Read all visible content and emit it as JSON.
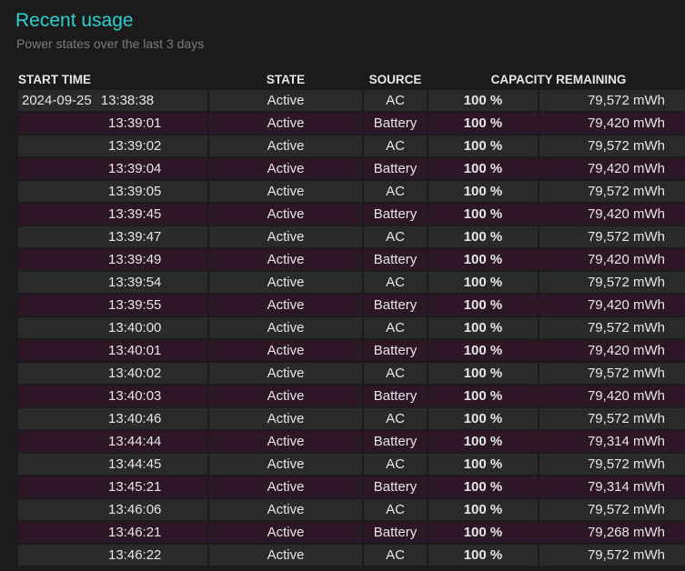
{
  "header": {
    "title": "Recent usage",
    "subtitle": "Power states over the last 3 days"
  },
  "table": {
    "columns": {
      "start_time": "START TIME",
      "state": "STATE",
      "source": "SOURCE",
      "capacity": "CAPACITY REMAINING"
    },
    "rows": [
      {
        "date": "2024-09-25",
        "time": "13:38:38",
        "state": "Active",
        "source": "AC",
        "percent": "100 %",
        "mwh": "79,572 mWh"
      },
      {
        "date": "",
        "time": "13:39:01",
        "state": "Active",
        "source": "Battery",
        "percent": "100 %",
        "mwh": "79,420 mWh"
      },
      {
        "date": "",
        "time": "13:39:02",
        "state": "Active",
        "source": "AC",
        "percent": "100 %",
        "mwh": "79,572 mWh"
      },
      {
        "date": "",
        "time": "13:39:04",
        "state": "Active",
        "source": "Battery",
        "percent": "100 %",
        "mwh": "79,420 mWh"
      },
      {
        "date": "",
        "time": "13:39:05",
        "state": "Active",
        "source": "AC",
        "percent": "100 %",
        "mwh": "79,572 mWh"
      },
      {
        "date": "",
        "time": "13:39:45",
        "state": "Active",
        "source": "Battery",
        "percent": "100 %",
        "mwh": "79,420 mWh"
      },
      {
        "date": "",
        "time": "13:39:47",
        "state": "Active",
        "source": "AC",
        "percent": "100 %",
        "mwh": "79,572 mWh"
      },
      {
        "date": "",
        "time": "13:39:49",
        "state": "Active",
        "source": "Battery",
        "percent": "100 %",
        "mwh": "79,420 mWh"
      },
      {
        "date": "",
        "time": "13:39:54",
        "state": "Active",
        "source": "AC",
        "percent": "100 %",
        "mwh": "79,572 mWh"
      },
      {
        "date": "",
        "time": "13:39:55",
        "state": "Active",
        "source": "Battery",
        "percent": "100 %",
        "mwh": "79,420 mWh"
      },
      {
        "date": "",
        "time": "13:40:00",
        "state": "Active",
        "source": "AC",
        "percent": "100 %",
        "mwh": "79,572 mWh"
      },
      {
        "date": "",
        "time": "13:40:01",
        "state": "Active",
        "source": "Battery",
        "percent": "100 %",
        "mwh": "79,420 mWh"
      },
      {
        "date": "",
        "time": "13:40:02",
        "state": "Active",
        "source": "AC",
        "percent": "100 %",
        "mwh": "79,572 mWh"
      },
      {
        "date": "",
        "time": "13:40:03",
        "state": "Active",
        "source": "Battery",
        "percent": "100 %",
        "mwh": "79,420 mWh"
      },
      {
        "date": "",
        "time": "13:40:46",
        "state": "Active",
        "source": "AC",
        "percent": "100 %",
        "mwh": "79,572 mWh"
      },
      {
        "date": "",
        "time": "13:44:44",
        "state": "Active",
        "source": "Battery",
        "percent": "100 %",
        "mwh": "79,314 mWh"
      },
      {
        "date": "",
        "time": "13:44:45",
        "state": "Active",
        "source": "AC",
        "percent": "100 %",
        "mwh": "79,572 mWh"
      },
      {
        "date": "",
        "time": "13:45:21",
        "state": "Active",
        "source": "Battery",
        "percent": "100 %",
        "mwh": "79,314 mWh"
      },
      {
        "date": "",
        "time": "13:46:06",
        "state": "Active",
        "source": "AC",
        "percent": "100 %",
        "mwh": "79,572 mWh"
      },
      {
        "date": "",
        "time": "13:46:21",
        "state": "Active",
        "source": "Battery",
        "percent": "100 %",
        "mwh": "79,268 mWh"
      },
      {
        "date": "",
        "time": "13:46:22",
        "state": "Active",
        "source": "AC",
        "percent": "100 %",
        "mwh": "79,572 mWh"
      }
    ]
  },
  "colors": {
    "title": "#2bd1d1",
    "row_odd": "#2a2a2a",
    "row_even": "#2d1626",
    "background": "#1b1b1b"
  }
}
